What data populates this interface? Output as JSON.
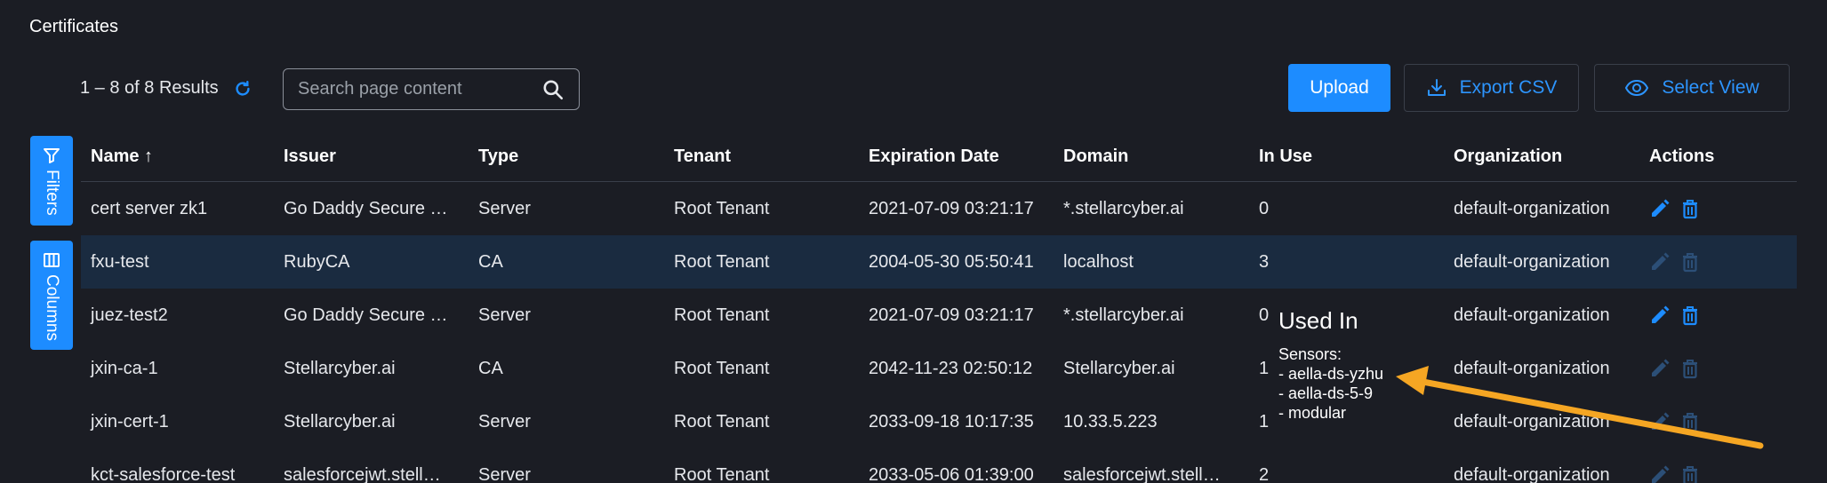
{
  "page": {
    "title": "Certificates"
  },
  "toolbar": {
    "results_label": "1 – 8 of 8 Results",
    "search_placeholder": "Search page content",
    "upload_label": "Upload",
    "export_label": "Export CSV",
    "select_view_label": "Select View"
  },
  "side_tabs": {
    "filters": "Filters",
    "columns": "Columns"
  },
  "table": {
    "headers": {
      "name": "Name",
      "issuer": "Issuer",
      "type": "Type",
      "tenant": "Tenant",
      "expiration": "Expiration Date",
      "domain": "Domain",
      "in_use": "In Use",
      "organization": "Organization",
      "actions": "Actions"
    },
    "sort_indicator": "↑",
    "rows": [
      {
        "name": "cert server zk1",
        "issuer": "Go Daddy Secure …",
        "type": "Server",
        "tenant": "Root Tenant",
        "expiration": "2021-07-09 03:21:17",
        "domain": "*.stellarcyber.ai",
        "in_use": "0",
        "organization": "default-organization",
        "actions_enabled": true
      },
      {
        "name": "fxu-test",
        "issuer": "RubyCA",
        "type": "CA",
        "tenant": "Root Tenant",
        "expiration": "2004-05-30 05:50:41",
        "domain": "localhost",
        "in_use": "3",
        "organization": "default-organization",
        "actions_enabled": false,
        "selected": true
      },
      {
        "name": "juez-test2",
        "issuer": "Go Daddy Secure …",
        "type": "Server",
        "tenant": "Root Tenant",
        "expiration": "2021-07-09 03:21:17",
        "domain": "*.stellarcyber.ai",
        "in_use": "0",
        "organization": "default-organization",
        "actions_enabled": true
      },
      {
        "name": "jxin-ca-1",
        "issuer": "Stellarcyber.ai",
        "type": "CA",
        "tenant": "Root Tenant",
        "expiration": "2042-11-23 02:50:12",
        "domain": "Stellarcyber.ai",
        "in_use": "1",
        "organization": "default-organization",
        "actions_enabled": false
      },
      {
        "name": "jxin-cert-1",
        "issuer": "Stellarcyber.ai",
        "type": "Server",
        "tenant": "Root Tenant",
        "expiration": "2033-09-18 10:17:35",
        "domain": "10.33.5.223",
        "in_use": "1",
        "organization": "default-organization",
        "actions_enabled": false
      },
      {
        "name": "kct-salesforce-test",
        "issuer": "salesforcejwt.stell…",
        "type": "Server",
        "tenant": "Root Tenant",
        "expiration": "2033-05-06 01:39:00",
        "domain": "salesforcejwt.stell…",
        "in_use": "2",
        "organization": "default-organization",
        "actions_enabled": false
      }
    ]
  },
  "tooltip": {
    "title": "Used In",
    "lines": [
      "Sensors:",
      "- aella-ds-yzhu",
      "- aella-ds-5-9",
      "- modular"
    ]
  },
  "icons": {
    "refresh": "refresh-icon",
    "search": "search-icon",
    "export": "download-icon",
    "select_view": "eye-icon",
    "filters": "filter-icon",
    "columns": "columns-icon",
    "edit": "pencil-icon",
    "delete": "trash-icon"
  },
  "colors": {
    "background": "#1b1d24",
    "accent": "#1d8cff",
    "selected_row": "#1a2b40",
    "annotation_arrow": "#f5a623"
  }
}
